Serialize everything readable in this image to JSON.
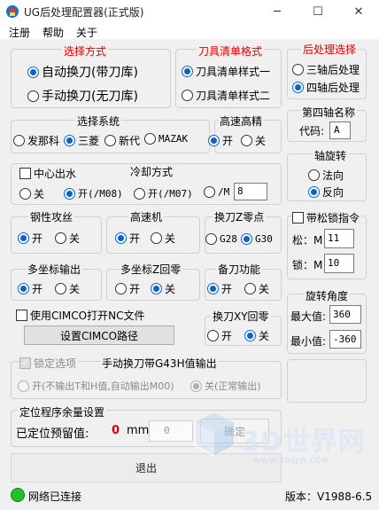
{
  "window": {
    "title": "UG后处理配置器(正式版)",
    "minimize": "─",
    "maximize": "☐",
    "close": "✕"
  },
  "menu": [
    "注册",
    "帮助",
    "关于"
  ],
  "tool_change": {
    "title": "选择方式",
    "options": [
      "自动换刀(带刀库)",
      "手动换刀(无刀库)"
    ],
    "selected": 0
  },
  "tool_list": {
    "title": "刀具清单格式",
    "options": [
      "刀具清单样式一",
      "刀具清单样式二"
    ],
    "selected": 0
  },
  "post_select": {
    "title": "后处理选择",
    "options": [
      "三轴后处理",
      "四轴后处理"
    ],
    "selected": 1
  },
  "system": {
    "title": "选择系统",
    "options": [
      "发那科",
      "三菱",
      "新代",
      "MAZAK"
    ],
    "selected": 1
  },
  "high_precision": {
    "title": "高速高精",
    "options": [
      "开",
      "关"
    ],
    "selected": 0
  },
  "fourth_axis": {
    "title": "第四轴名称",
    "code_label": "代码:",
    "code_value": "A"
  },
  "coolant": {
    "center_water_label": "中心出水",
    "center_water_checked": false,
    "title": "冷却方式",
    "options": [
      "关",
      "开(/M08)",
      "开(/M07)",
      "/M"
    ],
    "selected": 1,
    "custom_value": "8"
  },
  "axis_rotation": {
    "title": "轴旋转",
    "options": [
      "法向",
      "反向"
    ],
    "selected": 1
  },
  "tapping": {
    "title": "钢性攻丝",
    "options": [
      "开",
      "关"
    ],
    "selected": 0
  },
  "high_speed": {
    "title": "高速机",
    "options": [
      "开",
      "关"
    ],
    "selected": 0
  },
  "tool_change_z": {
    "title": "换刀Z零点",
    "options": [
      "G28",
      "G30"
    ],
    "selected": 1
  },
  "clamp": {
    "title": "带松锁指令",
    "checked": false,
    "release_label": "松：M",
    "release_value": "11",
    "lock_label": "锁：M",
    "lock_value": "10"
  },
  "multi_coord": {
    "title": "多坐标输出",
    "options": [
      "开",
      "关"
    ],
    "selected": 0
  },
  "multi_z_return": {
    "title": "多坐标Z回零",
    "options": [
      "开",
      "关"
    ],
    "selected": 1
  },
  "spare_tool": {
    "title": "备刀功能",
    "options": [
      "开",
      "关"
    ],
    "selected": 0
  },
  "cimco": {
    "checkbox_label": "使用CIMCO打开NC文件",
    "checked": false,
    "button_label": "设置CIMCO路径"
  },
  "xy_return": {
    "title": "换刀XY回零",
    "options": [
      "开",
      "关"
    ],
    "selected": 1
  },
  "rotation_angle": {
    "title": "旋转角度",
    "max_label": "最大值:",
    "max_value": "360",
    "min_label": "最小值:",
    "min_value": "-360"
  },
  "lock_options": {
    "checkbox_label": "锁定选项",
    "checked": true,
    "g43_label": "手动换刀带G43H值输出",
    "options": [
      "开(不输出T和H值,自动输出M00)",
      "关(正常输出)"
    ],
    "selected": 1
  },
  "positioning": {
    "title": "定位程序余量设置",
    "label": "已定位预留值:",
    "value": "0",
    "unit": "mm",
    "input_value": "0",
    "confirm_label": "确定"
  },
  "exit_label": "退出",
  "status": {
    "connection": "网络已连接",
    "version": "版本：V1988-6.5"
  },
  "watermark": {
    "text": "3D世界网",
    "url": "WWW.3DSJW.COM"
  },
  "colors": {
    "accent": "#0a64c8",
    "section_title_red": "#e00000",
    "status_ok": "#22c02a"
  }
}
